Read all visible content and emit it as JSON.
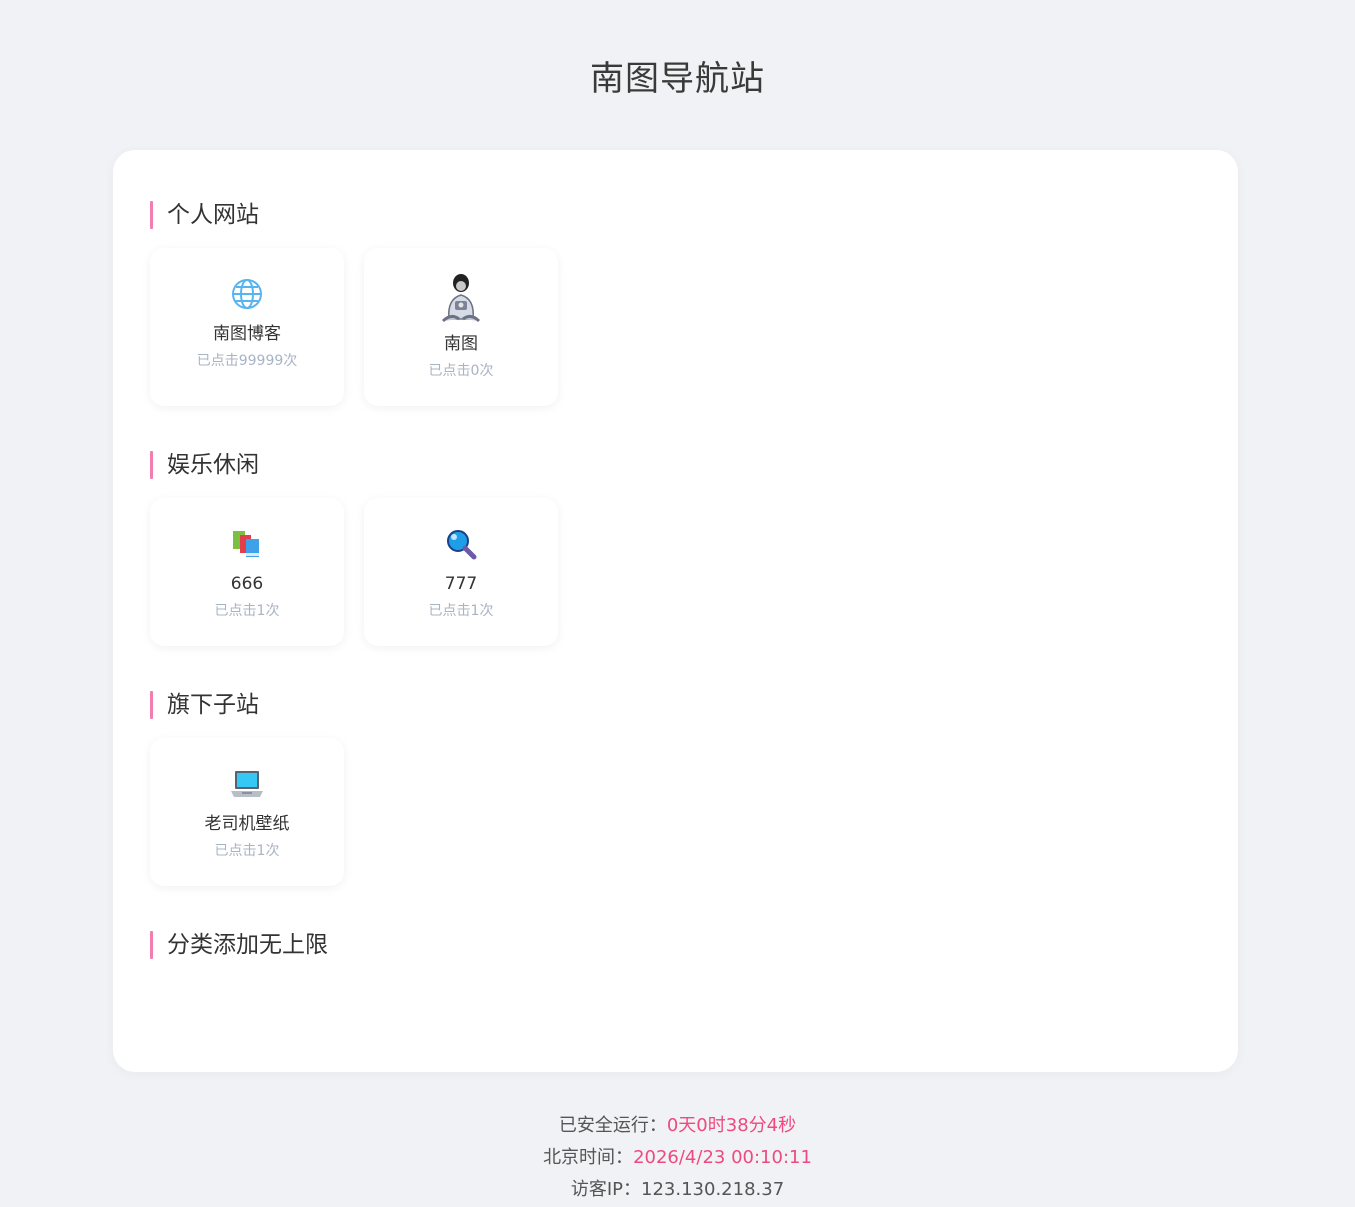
{
  "header": {
    "title": "南图导航站"
  },
  "sections": [
    {
      "title": "个人网站",
      "items": [
        {
          "name": "南图博客",
          "clicks": "已点击99999次",
          "icon": "globe-icon"
        },
        {
          "name": "南图",
          "clicks": "已点击0次",
          "icon": "astronaut-avatar-icon"
        }
      ]
    },
    {
      "title": "娱乐休闲",
      "items": [
        {
          "name": "666",
          "clicks": "已点击1次",
          "icon": "books-icon"
        },
        {
          "name": "777",
          "clicks": "已点击1次",
          "icon": "magnifier-icon"
        }
      ]
    },
    {
      "title": "旗下子站",
      "items": [
        {
          "name": "老司机壁纸",
          "clicks": "已点击1次",
          "icon": "laptop-icon"
        }
      ]
    },
    {
      "title": "分类添加无上限",
      "items": []
    }
  ],
  "footer": {
    "runtime_label": "已安全运行：",
    "runtime_value": "0天0时38分4秒",
    "time_label": "北京时间：",
    "time_value": "2026/4/23 00:10:11",
    "ip_label": "访客IP：",
    "ip_value": "123.130.218.37"
  },
  "colors": {
    "accent": "#f27eb0",
    "highlight": "#ee4a7f",
    "background": "#f0f2f5"
  }
}
